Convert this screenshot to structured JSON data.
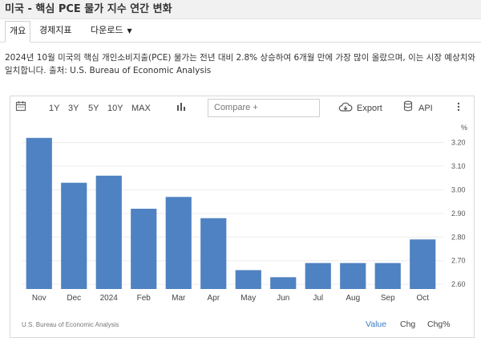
{
  "window": {
    "title": "미국 - 핵심 PCE 물가 지수 연간 변화"
  },
  "tabs": [
    {
      "label": "개요"
    },
    {
      "label": "경제지표"
    },
    {
      "label": "다운로드"
    }
  ],
  "description": "2024년 10월 미국의 핵심 개인소비지출(PCE) 물가는 전년 대비 2.8% 상승하여 6개월 만에 가장 많이 올랐으며, 이는 시장 예상치와 일치합니다. 출처: U.S. Bureau of Economic Analysis",
  "toolbar": {
    "ranges": [
      "1Y",
      "3Y",
      "5Y",
      "10Y",
      "MAX"
    ],
    "compare_placeholder": "Compare +",
    "export_label": "Export",
    "api_label": "API",
    "icons": [
      "calendar-icon",
      "bar-chart-icon",
      "cloud-download-icon",
      "database-icon",
      "more-vertical-icon"
    ]
  },
  "chart_data": {
    "type": "bar",
    "categories": [
      "Nov",
      "Dec",
      "2024",
      "Feb",
      "Mar",
      "Apr",
      "May",
      "Jun",
      "Jul",
      "Aug",
      "Sep",
      "Oct"
    ],
    "values": [
      3.22,
      3.03,
      3.06,
      2.92,
      2.97,
      2.88,
      2.66,
      2.63,
      2.69,
      2.69,
      2.69,
      2.79
    ],
    "ylabel": "%",
    "ylim": [
      2.58,
      3.26
    ],
    "yticks": [
      "3.20",
      "3.10",
      "3.00",
      "2.90",
      "2.80",
      "2.70",
      "2.60"
    ],
    "bar_color": "#4f82c2",
    "grid": "horizontal"
  },
  "footer": {
    "source": "U.S. Bureau of Economic Analysis",
    "options": [
      "Value",
      "Chg",
      "Chg%"
    ],
    "active_color": "#3b7dc4"
  }
}
